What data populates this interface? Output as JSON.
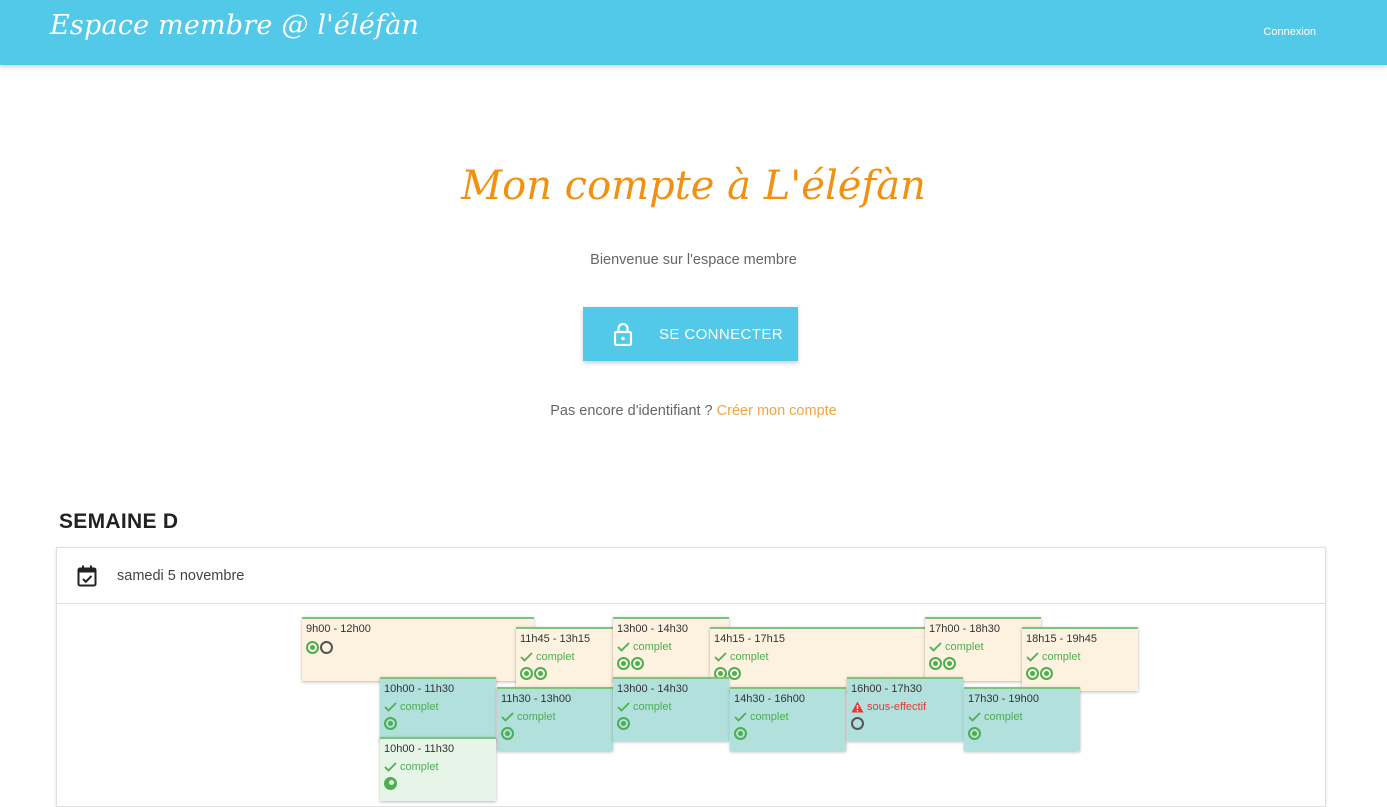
{
  "navbar": {
    "brand": "Espace membre @ l'éléfàn",
    "login_link": "Connexion"
  },
  "hero": {
    "title": "Mon compte à L'éléfàn",
    "welcome": "Bienvenue sur l'espace membre",
    "login_button": "SE CONNECTER",
    "signup_prefix": "Pas encore d'identifiant ? ",
    "signup_link": "Créer mon compte"
  },
  "schedule": {
    "week_title": "SEMAINE D",
    "day": "samedi 5 novembre",
    "slots": [
      {
        "time": "9h00 - 12h00",
        "status": "",
        "markers": [
          "filled",
          "empty"
        ],
        "color": "orange"
      },
      {
        "time": "11h45 - 13h15",
        "status": "complet",
        "markers": [
          "filled",
          "filled"
        ],
        "color": "orange"
      },
      {
        "time": "13h00 - 14h30",
        "status": "complet",
        "markers": [
          "filled",
          "filled"
        ],
        "color": "orange"
      },
      {
        "time": "14h15 - 17h15",
        "status": "complet",
        "markers": [
          "filled",
          "filled"
        ],
        "color": "orange"
      },
      {
        "time": "17h00 - 18h30",
        "status": "complet",
        "markers": [
          "filled",
          "filled"
        ],
        "color": "orange"
      },
      {
        "time": "18h15 - 19h45",
        "status": "complet",
        "markers": [
          "filled",
          "filled"
        ],
        "color": "orange"
      },
      {
        "time": "10h00 - 11h30",
        "status": "complet",
        "markers": [
          "filled"
        ],
        "color": "teal"
      },
      {
        "time": "11h30 - 13h00",
        "status": "complet",
        "markers": [
          "filled"
        ],
        "color": "teal"
      },
      {
        "time": "13h00 - 14h30",
        "status": "complet",
        "markers": [
          "filled"
        ],
        "color": "teal"
      },
      {
        "time": "14h30 - 16h00",
        "status": "complet",
        "markers": [
          "filled"
        ],
        "color": "teal"
      },
      {
        "time": "16h00 - 17h30",
        "status": "sous-effectif",
        "markers": [
          "empty"
        ],
        "color": "teal"
      },
      {
        "time": "17h30 - 19h00",
        "status": "complet",
        "markers": [
          "filled"
        ],
        "color": "teal"
      },
      {
        "time": "10h00 - 11h30",
        "status": "complet",
        "markers": [
          "person"
        ],
        "color": "green"
      }
    ]
  }
}
